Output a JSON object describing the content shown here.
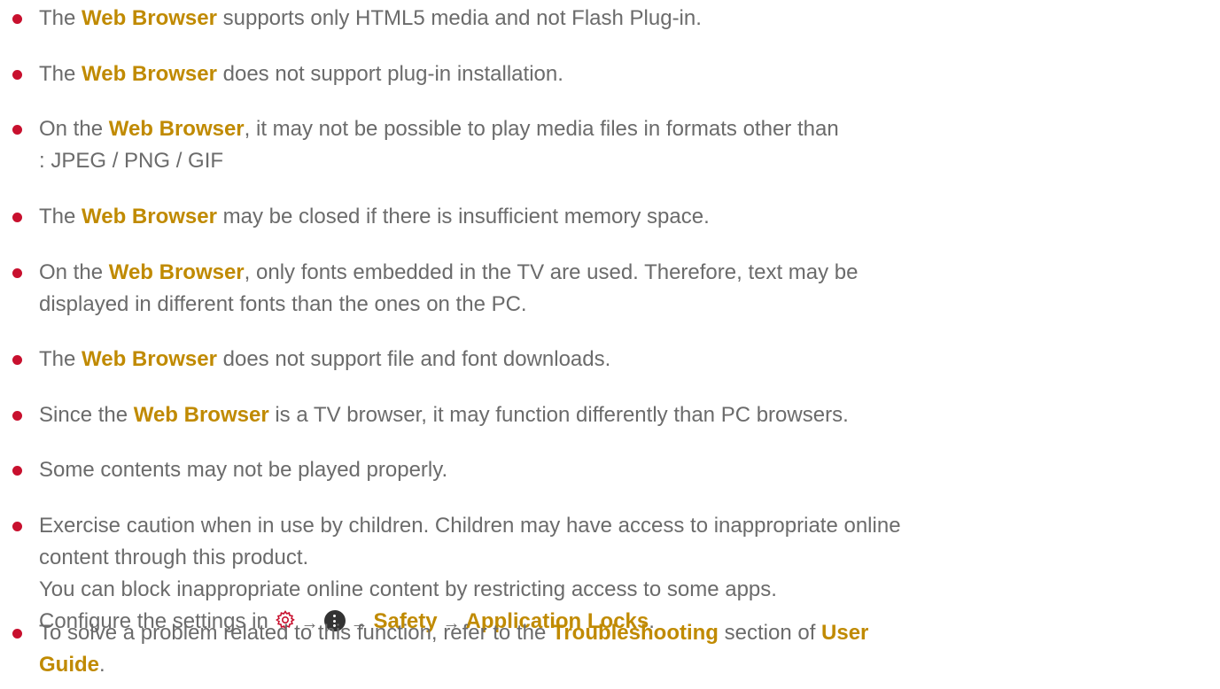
{
  "items": [
    {
      "pre": "The ",
      "hl": "Web Browser",
      "post": " supports only HTML5 media and not Flash Plug-in."
    },
    {
      "pre": "The ",
      "hl": "Web Browser",
      "post": " does not support plug-in installation."
    },
    {
      "pre": "On the ",
      "hl": "Web Browser",
      "post": ", it may not be possible to play media files in formats other than",
      "line2": ": JPEG / PNG / GIF"
    },
    {
      "pre": "The ",
      "hl": "Web Browser",
      "post": " may be closed if there is insufficient memory space."
    },
    {
      "pre": "On the ",
      "hl": "Web Browser",
      "post": ", only fonts embedded in the TV are used. Therefore, text may be",
      "line2": "displayed in different fonts than the ones on the PC."
    },
    {
      "pre": "The ",
      "hl": "Web Browser",
      "post": " does not support file and font downloads."
    },
    {
      "pre": "Since the ",
      "hl": "Web Browser",
      "post": " is a TV browser, it may function differently than PC browsers."
    },
    {
      "text": "Some contents may not be played properly."
    },
    {
      "line1": "Exercise caution when in use by children. Children may have access to inappropriate online",
      "line2": "content through this product.",
      "line3": "You can block inappropriate online content by restricting access to some apps.",
      "line4_pre": "Configure the settings in ",
      "arrow": "→",
      "safety": "Safety",
      "app_locks": "Application Locks",
      "period": "."
    },
    {
      "pre": "To solve a problem related to this function, refer to the ",
      "hl1": "Troubleshooting",
      "mid": " section of ",
      "hl2a": "User",
      "hl2b": "Guide",
      "period": "."
    }
  ],
  "colors": {
    "bullet": "#c8102e",
    "highlight": "#c08a00",
    "text": "#6b6b6b"
  },
  "icons": [
    "settings-gear-icon",
    "more-options-icon",
    "arrow-right-icon"
  ]
}
